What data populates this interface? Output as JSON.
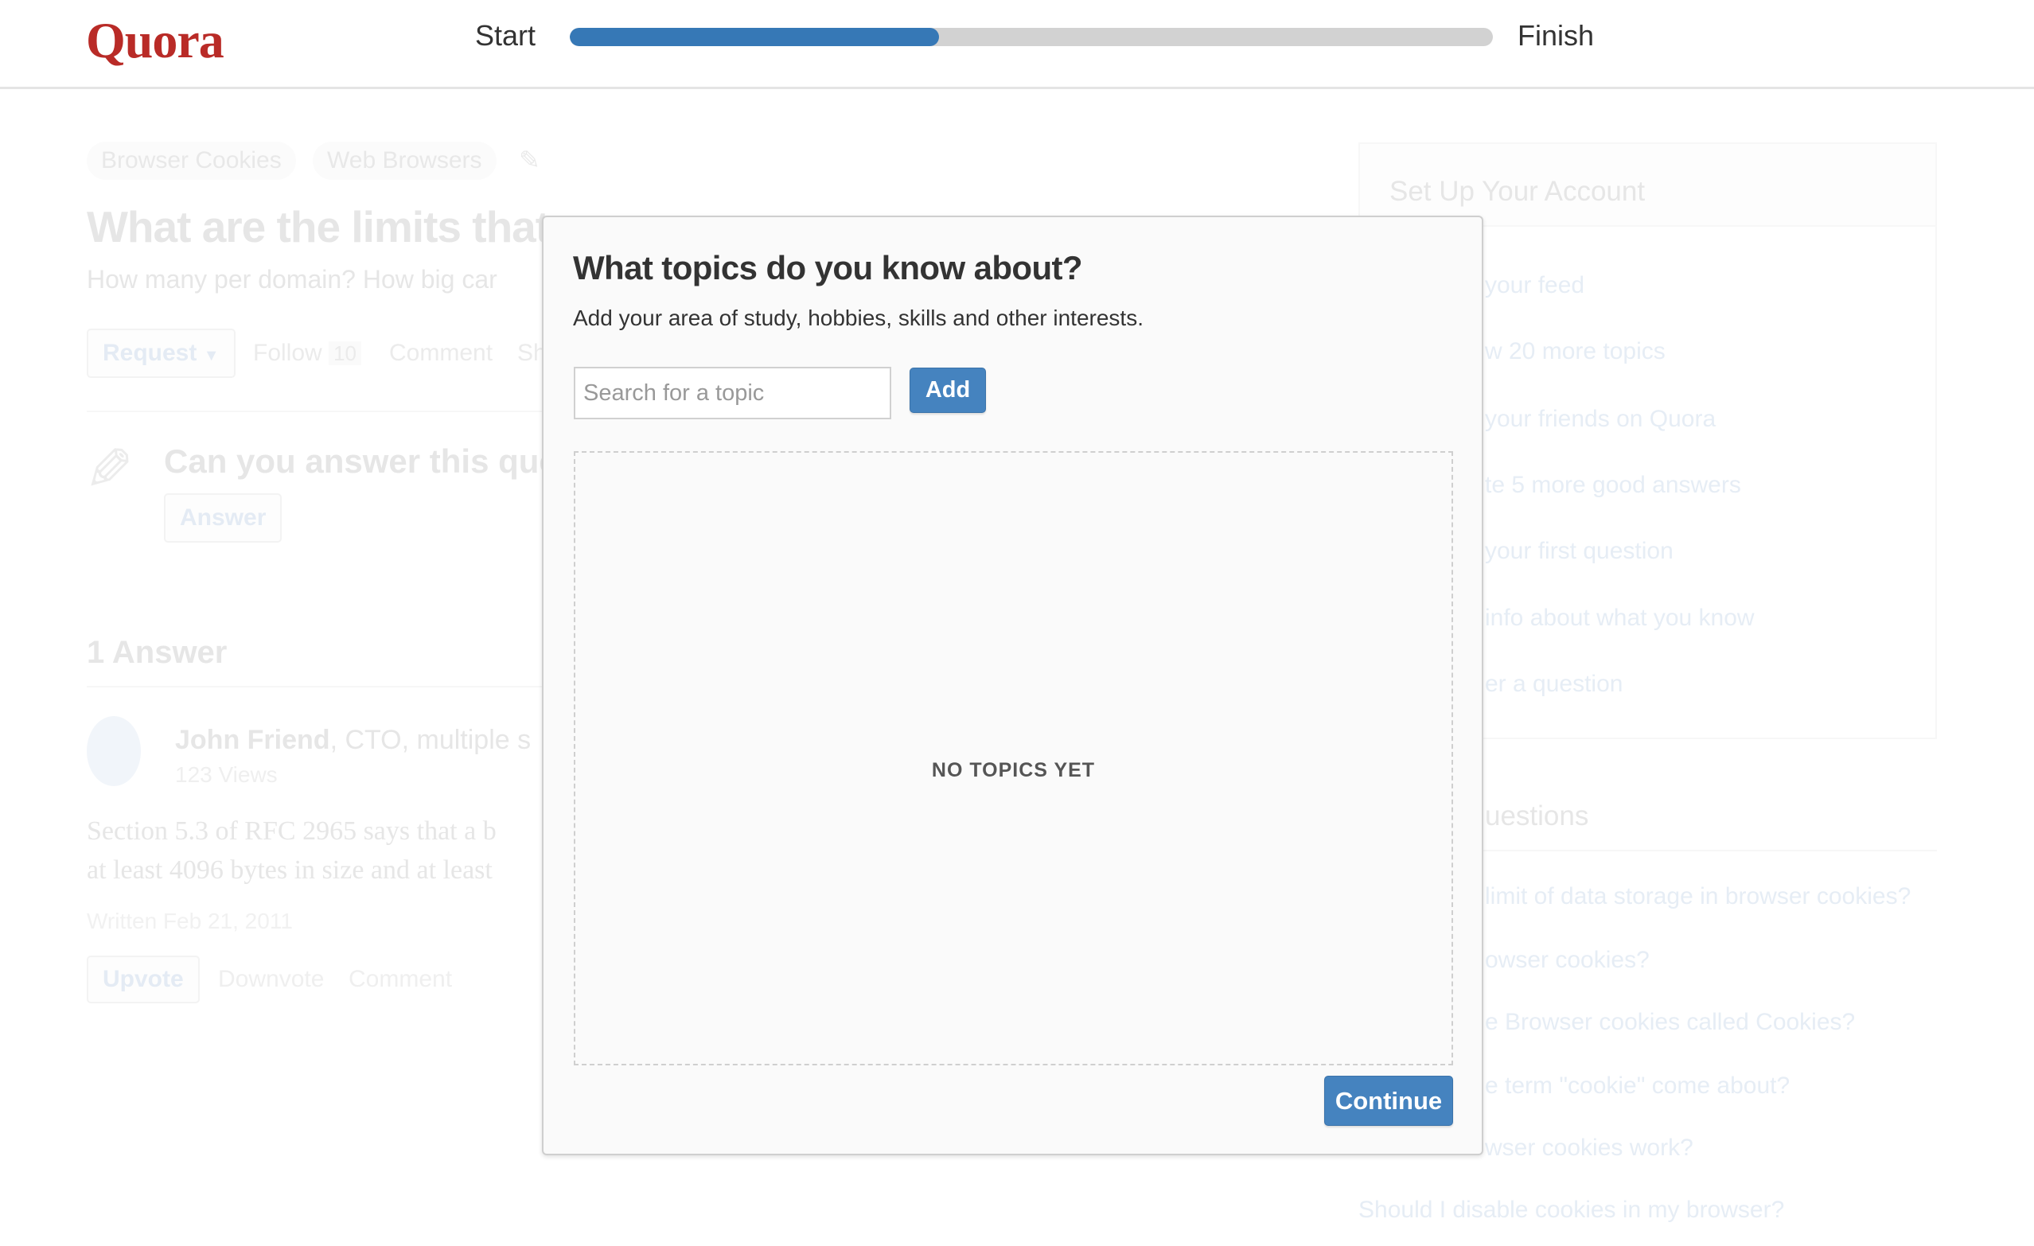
{
  "header": {
    "logo": "Quora",
    "progress_start": "Start",
    "progress_end": "Finish",
    "progress_fraction": 0.4,
    "accent": "#3678b6",
    "logo_color": "#b92b27"
  },
  "question": {
    "tags": [
      "Browser Cookies",
      "Web Browsers"
    ],
    "title": "What are the limits that",
    "details": "How many per domain? How big car",
    "actions": {
      "request": "Request",
      "follow": "Follow",
      "follow_count": "10",
      "comment": "Comment",
      "share": "Sh"
    },
    "prompt": "Can you answer this que",
    "answer_button": "Answer"
  },
  "answers": {
    "count_label": "1 Answer",
    "items": [
      {
        "author": "John Friend",
        "credential": ", CTO, multiple s",
        "views": "123 Views",
        "body_lines": [
          "Section 5.3 of RFC 2965 says that a b",
          "at least 4096 bytes in size and at least"
        ],
        "written": "Written Feb 21, 2011",
        "upvote": "Upvote",
        "downvote": "Downvote",
        "comment": "Comment"
      }
    ]
  },
  "sidebar": {
    "title": "Set Up Your Account",
    "items": [
      "your feed",
      "w 20 more topics",
      "your friends on Quora",
      "te 5 more good answers",
      "your first question",
      "info about what you know",
      "er a question"
    ],
    "related_title": "uestions",
    "related": [
      "limit of  data storage in browser cookies?",
      "owser cookies?",
      "e Browser cookies called Cookies?",
      "e term \"cookie\" come about?",
      "wser cookies work?",
      "Should I disable cookies in my browser?"
    ]
  },
  "modal": {
    "title": "What topics do you know about?",
    "subtitle": "Add your area of study, hobbies, skills and other interests.",
    "search_placeholder": "Search for a topic",
    "search_value": "",
    "add_label": "Add",
    "empty_text": "NO TOPICS YET",
    "continue_label": "Continue"
  }
}
